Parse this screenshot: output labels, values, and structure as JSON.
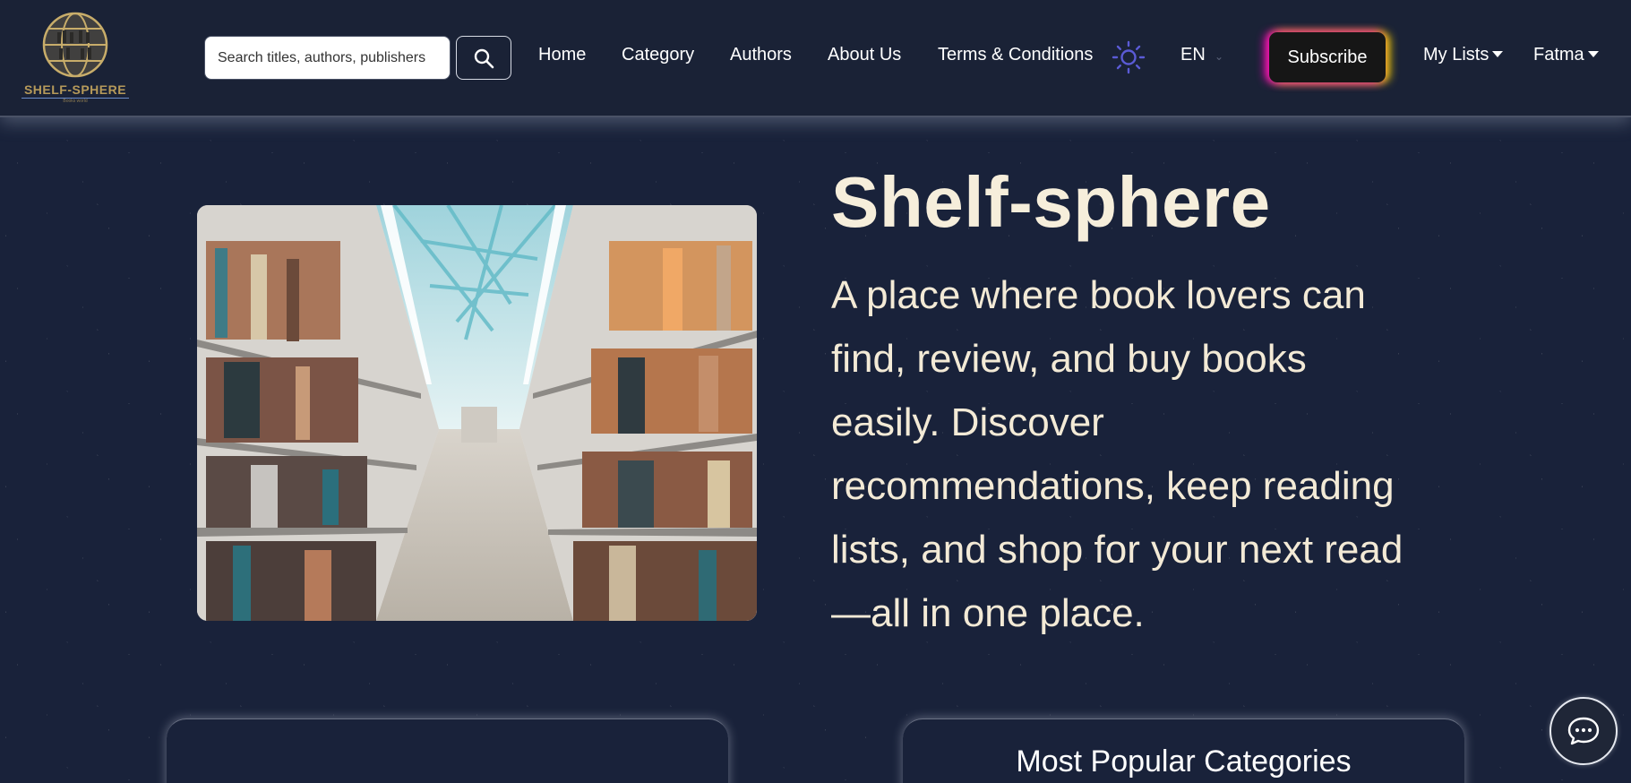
{
  "brand": {
    "logo_text": "SHELF-SPHERE",
    "logo_sub": "Books world"
  },
  "search": {
    "placeholder": "Search titles, authors, publishers",
    "icon": "search-icon"
  },
  "nav": {
    "home": "Home",
    "category": "Category",
    "authors": "Authors",
    "about": "About Us",
    "terms": "Terms & Conditions",
    "theme_icon": "sun-icon",
    "language": "EN",
    "subscribe": "Subscribe",
    "my_lists": "My Lists",
    "user": "Fatma"
  },
  "hero": {
    "title": "Shelf-sphere",
    "description": "A place where book lovers can find, review, and buy books easily. Discover recommendations, keep reading lists, and shop for your next read—all in one place.",
    "image": "library-bookshelves-image"
  },
  "cards": {
    "left_title": "",
    "right_title": "Most Popular Categories"
  },
  "chat": {
    "icon": "chat-icon"
  },
  "colors": {
    "background": "#19223a",
    "text": "#f3ead6",
    "theme_icon": "#5b5bd6",
    "logo_gold": "#b69a5a"
  }
}
